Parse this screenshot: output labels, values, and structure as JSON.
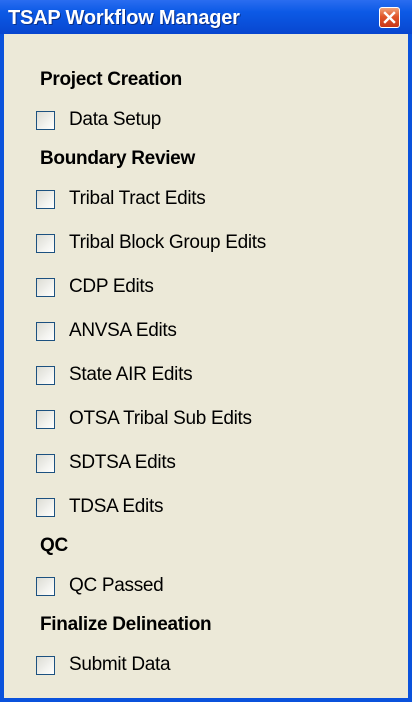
{
  "window": {
    "title": "TSAP Workflow Manager",
    "close_icon": "close-icon",
    "colors": {
      "titlebar": "#0c5ae6",
      "frame": "#0a52dc",
      "panel": "#ece9d8",
      "close_button": "#e0562a"
    }
  },
  "sections": [
    {
      "title": "Project Creation",
      "items": [
        {
          "label": "Data Setup",
          "checked": false
        }
      ]
    },
    {
      "title": "Boundary Review",
      "items": [
        {
          "label": "Tribal Tract Edits",
          "checked": false
        },
        {
          "label": "Tribal Block Group Edits",
          "checked": false
        },
        {
          "label": "CDP Edits",
          "checked": false
        },
        {
          "label": "ANVSA Edits",
          "checked": false
        },
        {
          "label": "State AIR Edits",
          "checked": false
        },
        {
          "label": "OTSA Tribal Sub Edits",
          "checked": false
        },
        {
          "label": "SDTSA Edits",
          "checked": false
        },
        {
          "label": "TDSA Edits",
          "checked": false
        }
      ]
    },
    {
      "title": "QC",
      "items": [
        {
          "label": "QC Passed",
          "checked": false
        }
      ]
    },
    {
      "title": "Finalize Delineation",
      "items": [
        {
          "label": "Submit Data",
          "checked": false
        }
      ]
    }
  ]
}
